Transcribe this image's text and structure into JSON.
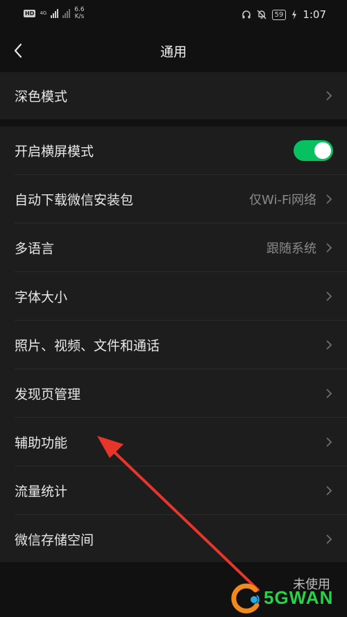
{
  "status_bar": {
    "hd_badge": "HD",
    "net_type": "4G",
    "speed_value": "6.6",
    "speed_unit": "K/s",
    "battery": "59",
    "time": "1:07"
  },
  "nav": {
    "title": "通用"
  },
  "settings": {
    "dark_mode": {
      "label": "深色模式"
    },
    "landscape": {
      "label": "开启横屏模式",
      "enabled": true
    },
    "auto_download": {
      "label": "自动下载微信安装包",
      "value": "仅Wi-Fi网络"
    },
    "language": {
      "label": "多语言",
      "value": "跟随系统"
    },
    "font_size": {
      "label": "字体大小"
    },
    "media": {
      "label": "照片、视频、文件和通话"
    },
    "discover": {
      "label": "发现页管理"
    },
    "accessibility": {
      "label": "辅助功能"
    },
    "traffic": {
      "label": "流量统计"
    },
    "storage": {
      "label": "微信存储空间"
    }
  },
  "watermark": {
    "text": "5GWAN",
    "partial_text": "未使用"
  },
  "colors": {
    "toggle_on": "#07c160",
    "annotation_arrow": "#e8352b",
    "watermark_green": "#29d24a"
  }
}
